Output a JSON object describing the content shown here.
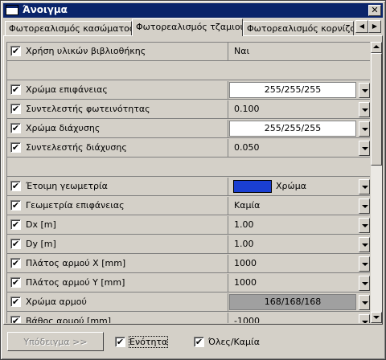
{
  "window": {
    "title": "Άνοιγμα",
    "close_symbol": "✕"
  },
  "tabs": [
    {
      "label": "Φωτορεαλισμός κασώματος",
      "active": false
    },
    {
      "label": "Φωτορεαλισμός τζαμιού",
      "active": true
    },
    {
      "label": "Φωτορεαλισμός κορνίζας",
      "active": false
    }
  ],
  "tab_scroll": {
    "left": "◀",
    "right": "▶"
  },
  "check_mark": "✔",
  "rows": [
    {
      "label": "Χρήση υλικών βιβλιοθήκης",
      "value": "Ναι",
      "style": "plain"
    },
    {
      "label": "Χρώμα επιφάνειας",
      "value": "255/255/255",
      "style": "white"
    },
    {
      "label": "Συντελεστής φωτεινότητας",
      "value": "0.100",
      "style": "plain"
    },
    {
      "label": "Χρώμα διάχυσης",
      "value": "255/255/255",
      "style": "white"
    },
    {
      "label": "Συντελεστής διάχυσης",
      "value": "0.050",
      "style": "plain"
    },
    {
      "label": "Έτοιμη γεωμετρία",
      "value": "Χρώμα",
      "style": "swatch",
      "swatch_color": "#1a3fd2"
    },
    {
      "label": "Γεωμετρία επιφάνειας",
      "value": "Καμία",
      "style": "plain"
    },
    {
      "label": "Dx [m]",
      "value": "1.00",
      "style": "plain"
    },
    {
      "label": "Dy [m]",
      "value": "1.00",
      "style": "plain"
    },
    {
      "label": "Πλάτος αρμού X [mm]",
      "value": "1000",
      "style": "plain"
    },
    {
      "label": "Πλάτος αρμού Y [mm]",
      "value": "1000",
      "style": "plain"
    },
    {
      "label": "Χρώμα αρμού",
      "value": "168/168/168",
      "style": "grey"
    },
    {
      "label": "Βάθος αρμού [mm]",
      "value": "-1000",
      "style": "plain"
    }
  ],
  "bottom": {
    "example_button": "Υπόδειγμα >>",
    "unit_checkbox": "Ενότητα",
    "all_none_checkbox": "Όλες/Καμία"
  }
}
